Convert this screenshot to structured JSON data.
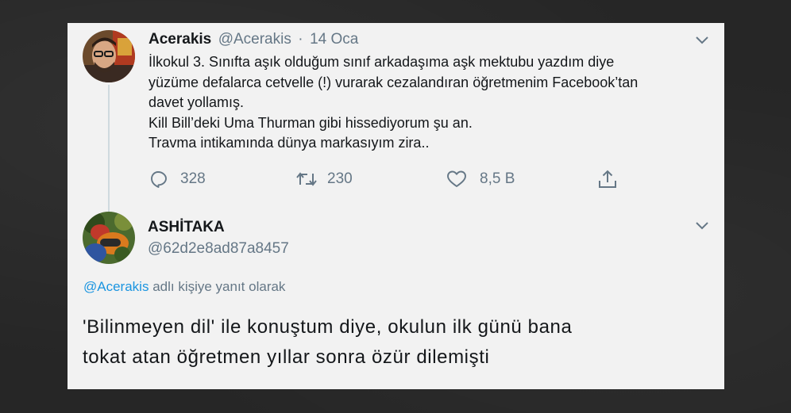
{
  "tweet": {
    "author_name": "Acerakis",
    "author_handle": "@Acerakis",
    "date_separator": "·",
    "date": "14 Oca",
    "text_lines": [
      "İlkokul 3. Sınıfta aşık olduğum sınıf arkadaşıma aşk mektubu yazdım diye",
      "yüzüme defalarca cetvelle (!) vurarak cezalandıran öğretmenim Facebook’tan",
      "davet yollamış.",
      "Kill Bill’deki Uma Thurman gibi hissediyorum şu an.",
      "Travma intikamında dünya markasıyım zira.."
    ],
    "replies_count": "328",
    "retweets_count": "230",
    "likes_count": "8,5 B",
    "icons": [
      "reply-icon",
      "retweet-icon",
      "like-icon",
      "share-icon",
      "chevron-down-icon"
    ]
  },
  "reply": {
    "author_name": "ASHİTAKA",
    "author_handle": "@62d2e8ad87a8457",
    "in_reply_to_mention": "@Acerakis",
    "in_reply_to_suffix": "adlı kişiye yanıt olarak",
    "text_lines": [
      "'Bilinmeyen dil' ile konuştum diye, okulun ilk günü bana",
      "tokat atan öğretmen yıllar sonra özür dilemişti"
    ]
  },
  "colors": {
    "card_bg": "#f2f2f2",
    "text": "#14171a",
    "muted": "#657786",
    "link": "#1b95e0",
    "thread_line": "#cfd9de"
  }
}
